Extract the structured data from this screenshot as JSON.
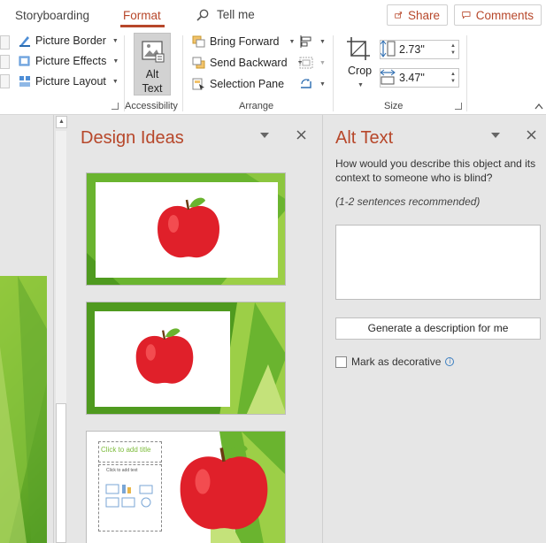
{
  "tabs": [
    {
      "label": "Storyboarding",
      "active": false
    },
    {
      "label": "Format",
      "active": true
    }
  ],
  "tell_me": {
    "label": "Tell me",
    "icon": "search-icon"
  },
  "share_button": {
    "label": "Share",
    "icon": "share-icon"
  },
  "comments_button": {
    "label": "Comments",
    "icon": "comment-icon"
  },
  "ribbon": {
    "picture_styles": {
      "items": [
        {
          "label": "Picture Border",
          "icon": "picture-border-icon"
        },
        {
          "label": "Picture Effects",
          "icon": "picture-effects-icon"
        },
        {
          "label": "Picture Layout",
          "icon": "picture-layout-icon"
        }
      ]
    },
    "accessibility": {
      "alt_text_line1": "Alt",
      "alt_text_line2": "Text",
      "group_label": "Accessibility"
    },
    "arrange": {
      "items": [
        {
          "label": "Bring Forward",
          "icon": "bring-forward-icon"
        },
        {
          "label": "Send Backward",
          "icon": "send-backward-icon"
        },
        {
          "label": "Selection Pane",
          "icon": "selection-pane-icon"
        }
      ],
      "group_label": "Arrange"
    },
    "size": {
      "crop_label": "Crop",
      "height_value": "2.73\"",
      "width_value": "3.47\"",
      "group_label": "Size"
    }
  },
  "design_ideas": {
    "title": "Design Ideas",
    "thumb3_title_placeholder": "Click to add title",
    "thumb3_text_placeholder": "Click to add text"
  },
  "alt_text_pane": {
    "title": "Alt Text",
    "description": "How would you describe this object and its context to someone who is blind?",
    "hint": "(1-2 sentences recommended)",
    "textarea_value": "",
    "generate_button": "Generate a description for me",
    "decorative_label": "Mark as decorative",
    "decorative_checked": false
  },
  "colors": {
    "accent": "#b7472a",
    "slide_green": "#78b832",
    "apple_red": "#e0202a"
  }
}
